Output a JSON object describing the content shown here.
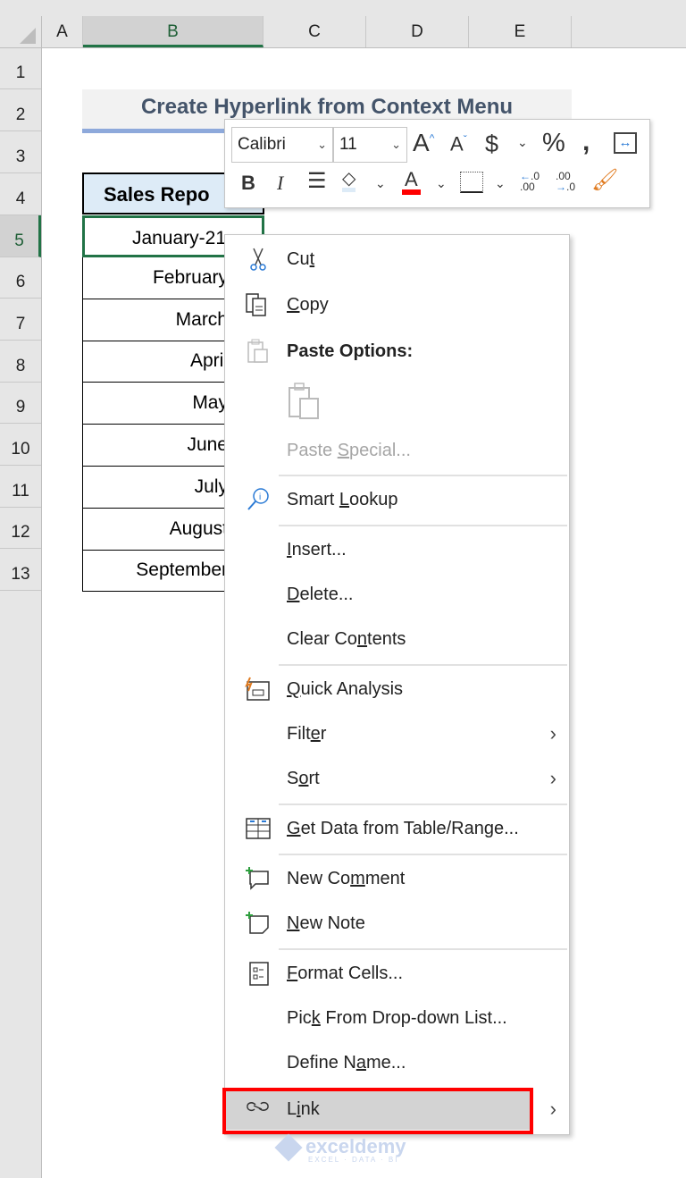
{
  "spreadsheet": {
    "columns": [
      "A",
      "B",
      "C",
      "D",
      "E"
    ],
    "selected_column": "B",
    "rows": [
      "1",
      "2",
      "3",
      "4",
      "5",
      "6",
      "7",
      "8",
      "9",
      "10",
      "11",
      "12",
      "13"
    ],
    "selected_row": "5",
    "title": "Create Hyperlink from Context Menu",
    "table_header": "Sales Repo",
    "table_rows": [
      "January-21",
      "February",
      "March",
      "April",
      "May",
      "June",
      "July",
      "August",
      "September"
    ]
  },
  "mini_toolbar": {
    "font_name": "Calibri",
    "font_size": "11",
    "fill_color": "#ddebf7",
    "font_color": "#ff0000",
    "buttons": [
      "increase-font-size",
      "decrease-font-size",
      "accounting-format",
      "percent-style",
      "comma-style",
      "merge-center",
      "bold",
      "italic",
      "center-align",
      "fill-color",
      "font-color",
      "borders",
      "increase-decimal",
      "decrease-decimal",
      "format-painter"
    ]
  },
  "context_menu": {
    "items": [
      {
        "label": "Cut",
        "underline": "t",
        "icon": "scissors-icon"
      },
      {
        "label": "Copy",
        "underline": "C",
        "icon": "copy-icon"
      },
      {
        "label": "Paste Options:",
        "icon": "paste-icon",
        "bold": true
      },
      {
        "label": "Paste Special...",
        "underline": "S",
        "disabled": true
      },
      {
        "label": "Smart Lookup",
        "underline": "L",
        "icon": "smart-lookup-icon"
      },
      {
        "label": "Insert...",
        "underline": "I"
      },
      {
        "label": "Delete...",
        "underline": "D"
      },
      {
        "label": "Clear Contents",
        "underline": "n"
      },
      {
        "label": "Quick Analysis",
        "underline": "Q",
        "icon": "quick-analysis-icon"
      },
      {
        "label": "Filter",
        "underline": "e",
        "submenu": true
      },
      {
        "label": "Sort",
        "underline": "o",
        "submenu": true
      },
      {
        "label": "Get Data from Table/Range...",
        "underline": "G",
        "icon": "table-icon"
      },
      {
        "label": "New Comment",
        "underline": "m",
        "icon": "new-comment-icon"
      },
      {
        "label": "New Note",
        "underline": "N",
        "icon": "new-note-icon"
      },
      {
        "label": "Format Cells...",
        "underline": "F",
        "icon": "format-cells-icon"
      },
      {
        "label": "Pick From Drop-down List...",
        "underline": "k"
      },
      {
        "label": "Define Name...",
        "underline": "a"
      },
      {
        "label": "Link",
        "underline": "i",
        "icon": "link-icon",
        "submenu": true,
        "highlighted": true
      }
    ],
    "submenu_arrow": "›",
    "highlight_box_color": "#ff0000"
  },
  "watermark": {
    "brand": "exceldemy",
    "tagline": "EXCEL · DATA · BI"
  }
}
